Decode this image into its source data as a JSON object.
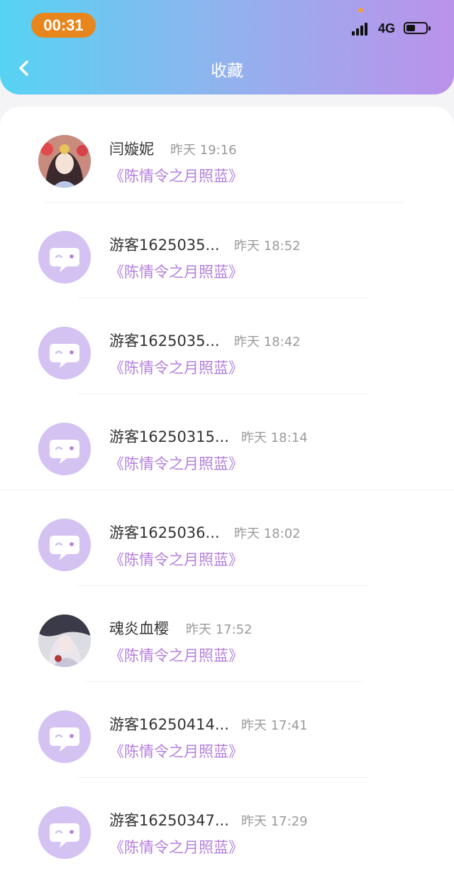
{
  "status_bar": {
    "time": "00:31",
    "network": "4G"
  },
  "header": {
    "title": "收藏"
  },
  "items": [
    {
      "name": "闫嫙妮",
      "time": "昨天 19:16",
      "book": "《陈情令之月照蓝》",
      "avatar": "photo-avatar-girl-icon"
    },
    {
      "name": "游客1625035...",
      "time": "昨天 18:52",
      "book": "《陈情令之月照蓝》",
      "avatar": "guest-chat-bubble-icon"
    },
    {
      "name": "游客1625035...",
      "time": "昨天 18:42",
      "book": "《陈情令之月照蓝》",
      "avatar": "guest-chat-bubble-icon"
    },
    {
      "name": "游客16250315...",
      "time": "昨天 18:14",
      "book": "《陈情令之月照蓝》",
      "avatar": "guest-chat-bubble-icon"
    },
    {
      "name": "游客1625036...",
      "time": "昨天 18:02",
      "book": "《陈情令之月照蓝》",
      "avatar": "guest-chat-bubble-icon"
    },
    {
      "name": "魂炎血樱",
      "time": "昨天 17:52",
      "book": "《陈情令之月照蓝》",
      "avatar": "photo-avatar-dark-icon"
    },
    {
      "name": "游客16250414...",
      "time": "昨天 17:41",
      "book": "《陈情令之月照蓝》",
      "avatar": "guest-chat-bubble-icon"
    },
    {
      "name": "游客16250347...",
      "time": "昨天 17:29",
      "book": "《陈情令之月照蓝》",
      "avatar": "guest-chat-bubble-icon"
    }
  ],
  "colors": {
    "accent": "#b37fdc",
    "header_left": "#56d3f3",
    "header_right": "#bb92ea",
    "time_pill": "#e8861e"
  }
}
